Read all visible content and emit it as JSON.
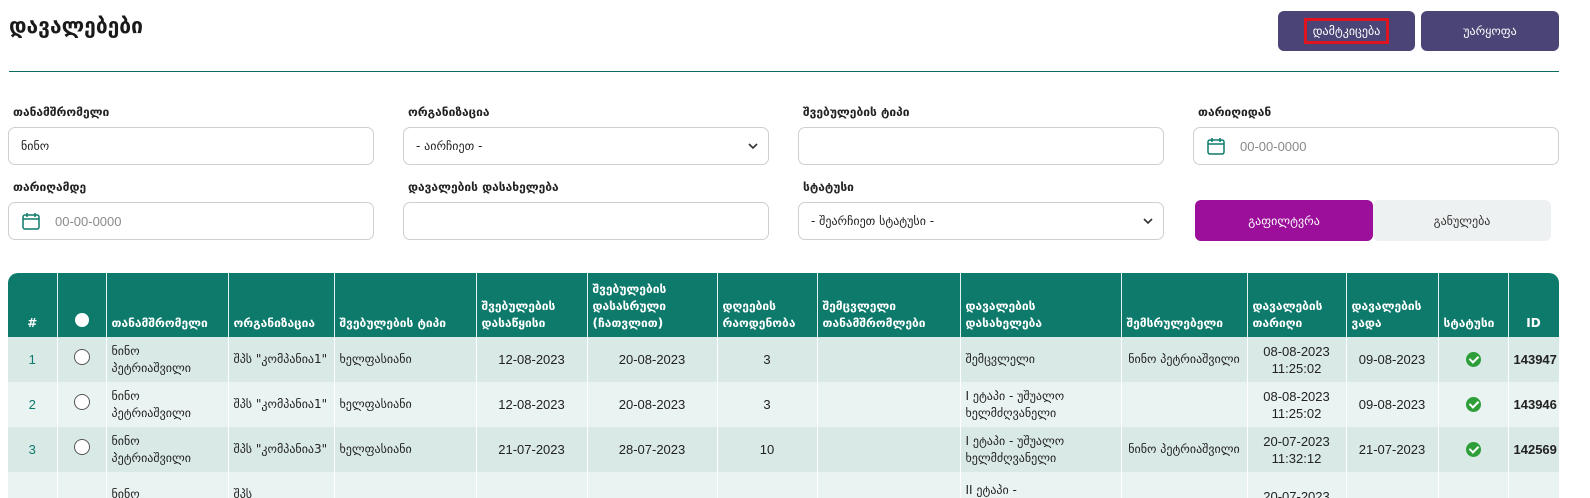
{
  "title": "დავალებები",
  "actions": {
    "approve": "დამტკიცება",
    "reject": "უარყოფა"
  },
  "filters": {
    "employee": {
      "label": "თანამშრომელი",
      "value": "ნინო"
    },
    "organization": {
      "label": "ორგანიზაცია",
      "value": "- აირჩიეთ -"
    },
    "leave_type": {
      "label": "შვებულების ტიპი",
      "value": ""
    },
    "date_from": {
      "label": "თარიღიდან",
      "placeholder": "00-00-0000"
    },
    "date_to": {
      "label": "თარიღამდე",
      "placeholder": "00-00-0000"
    },
    "task_name": {
      "label": "დავალების დასახელება",
      "value": ""
    },
    "status": {
      "label": "სტატუსი",
      "value": "- შეარჩიეთ სტატუსი -"
    },
    "filter_button": "გაფილტვრა",
    "reset_button": "განულება"
  },
  "table": {
    "headers": [
      "#",
      "",
      "თანამშრომელი",
      "ორგანიზაცია",
      "შვებულების ტიპი",
      "შვებულების დასაწყისი",
      "შვებულების დასასრული (ჩათვლით)",
      "დღეების რაოდენობა",
      "შემცვლელი თანამშრომლები",
      "დავალების დასახელება",
      "შემსრულებელი",
      "დავალების თარიღი",
      "დავალების ვადა",
      "სტატუსი",
      "ID"
    ],
    "rows": [
      {
        "n": "1",
        "employee": "ნინო პეტრიაშვილი",
        "org": "შპს \"კომპანია1\"",
        "type": "ხელფასიანი",
        "start": "12-08-2023",
        "end": "20-08-2023",
        "days": "3",
        "substitutes": "",
        "task": "შემცვლელი",
        "executor": "ნინო პეტრიაშვილი",
        "date": "08-08-2023",
        "time": "11:25:02",
        "deadline": "09-08-2023",
        "status": "approved",
        "id": "143947"
      },
      {
        "n": "2",
        "employee": "ნინო პეტრიაშვილი",
        "org": "შპს \"კომპანია1\"",
        "type": "ხელფასიანი",
        "start": "12-08-2023",
        "end": "20-08-2023",
        "days": "3",
        "substitutes": "",
        "task": "I ეტაპი - უშუალო ხელმძღვანელი",
        "executor": "",
        "date": "08-08-2023",
        "time": "11:25:02",
        "deadline": "09-08-2023",
        "status": "approved",
        "id": "143946"
      },
      {
        "n": "3",
        "employee": "ნინო პეტრიაშვილი",
        "org": "შპს \"კომპანია3\"",
        "type": "ხელფასიანი",
        "start": "21-07-2023",
        "end": "28-07-2023",
        "days": "10",
        "substitutes": "",
        "task": "I ეტაპი - უშუალო ხელმძღვანელი",
        "executor": "ნინო პეტრიაშვილი",
        "date": "20-07-2023",
        "time": "11:32:12",
        "deadline": "21-07-2023",
        "status": "approved",
        "id": "142569"
      },
      {
        "n": "",
        "employee": "ნინო",
        "org": "შპს",
        "type": "",
        "start": "",
        "end": "",
        "days": "",
        "substitutes": "",
        "task": "II ეტაპი -",
        "executor": "",
        "date": "20-07-2023",
        "time": "",
        "deadline": "",
        "status": "",
        "id": ""
      }
    ]
  },
  "colors": {
    "primary": "#4a4576",
    "accent": "#9b0f9b",
    "header": "#0d7a6c",
    "highlight": "#e0141e",
    "success": "#2e9e3a"
  },
  "icons": [
    "calendar-icon",
    "chevron-down-icon",
    "check-circle-icon"
  ]
}
